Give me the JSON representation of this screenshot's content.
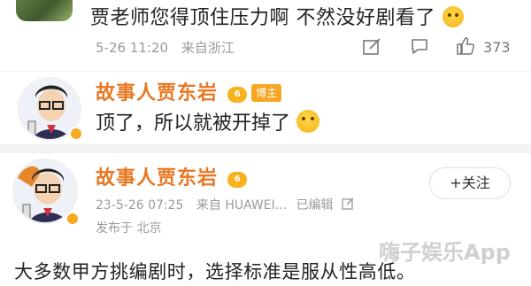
{
  "top_comment": {
    "text": "贾老师您得顶住压力啊 不然没好剧看了",
    "time": "5-26 11:20",
    "location": "来自浙江",
    "like_count": "373",
    "icons": [
      "reply-icon",
      "comment-icon",
      "like-icon"
    ]
  },
  "author_reply": {
    "name": "故事人贾东岩",
    "level": "6",
    "badge": "博主",
    "text": "顶了，所以就被开掉了"
  },
  "post": {
    "name": "故事人贾东岩",
    "level": "6",
    "datetime": "23-5-26 07:25",
    "source": "来自 HUAWEI...",
    "edited": "已编辑",
    "published_from": "发布于 北京",
    "follow_label": "+关注",
    "body": "大多数甲方挑编剧时，选择标准是服从性高低。",
    "watermark": "嗨子娱乐App"
  },
  "colors": {
    "author_name": "#e87722",
    "badge": "#f5a623",
    "meta": "#9a9a9a"
  }
}
